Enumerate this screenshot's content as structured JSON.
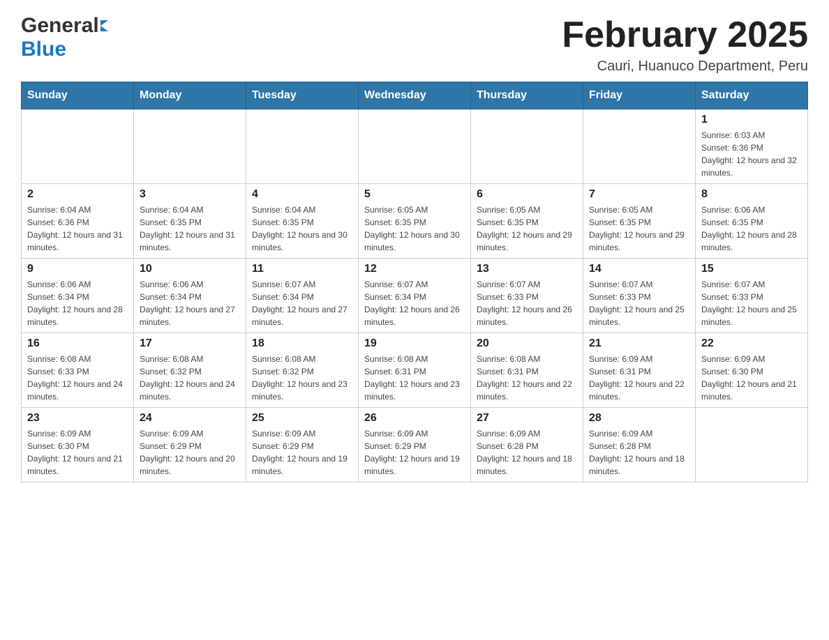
{
  "logo": {
    "general": "General",
    "blue": "Blue"
  },
  "header": {
    "title": "February 2025",
    "subtitle": "Cauri, Huanuco Department, Peru"
  },
  "weekdays": [
    "Sunday",
    "Monday",
    "Tuesday",
    "Wednesday",
    "Thursday",
    "Friday",
    "Saturday"
  ],
  "weeks": [
    [
      {
        "day": "",
        "info": ""
      },
      {
        "day": "",
        "info": ""
      },
      {
        "day": "",
        "info": ""
      },
      {
        "day": "",
        "info": ""
      },
      {
        "day": "",
        "info": ""
      },
      {
        "day": "",
        "info": ""
      },
      {
        "day": "1",
        "info": "Sunrise: 6:03 AM\nSunset: 6:36 PM\nDaylight: 12 hours and 32 minutes."
      }
    ],
    [
      {
        "day": "2",
        "info": "Sunrise: 6:04 AM\nSunset: 6:36 PM\nDaylight: 12 hours and 31 minutes."
      },
      {
        "day": "3",
        "info": "Sunrise: 6:04 AM\nSunset: 6:35 PM\nDaylight: 12 hours and 31 minutes."
      },
      {
        "day": "4",
        "info": "Sunrise: 6:04 AM\nSunset: 6:35 PM\nDaylight: 12 hours and 30 minutes."
      },
      {
        "day": "5",
        "info": "Sunrise: 6:05 AM\nSunset: 6:35 PM\nDaylight: 12 hours and 30 minutes."
      },
      {
        "day": "6",
        "info": "Sunrise: 6:05 AM\nSunset: 6:35 PM\nDaylight: 12 hours and 29 minutes."
      },
      {
        "day": "7",
        "info": "Sunrise: 6:05 AM\nSunset: 6:35 PM\nDaylight: 12 hours and 29 minutes."
      },
      {
        "day": "8",
        "info": "Sunrise: 6:06 AM\nSunset: 6:35 PM\nDaylight: 12 hours and 28 minutes."
      }
    ],
    [
      {
        "day": "9",
        "info": "Sunrise: 6:06 AM\nSunset: 6:34 PM\nDaylight: 12 hours and 28 minutes."
      },
      {
        "day": "10",
        "info": "Sunrise: 6:06 AM\nSunset: 6:34 PM\nDaylight: 12 hours and 27 minutes."
      },
      {
        "day": "11",
        "info": "Sunrise: 6:07 AM\nSunset: 6:34 PM\nDaylight: 12 hours and 27 minutes."
      },
      {
        "day": "12",
        "info": "Sunrise: 6:07 AM\nSunset: 6:34 PM\nDaylight: 12 hours and 26 minutes."
      },
      {
        "day": "13",
        "info": "Sunrise: 6:07 AM\nSunset: 6:33 PM\nDaylight: 12 hours and 26 minutes."
      },
      {
        "day": "14",
        "info": "Sunrise: 6:07 AM\nSunset: 6:33 PM\nDaylight: 12 hours and 25 minutes."
      },
      {
        "day": "15",
        "info": "Sunrise: 6:07 AM\nSunset: 6:33 PM\nDaylight: 12 hours and 25 minutes."
      }
    ],
    [
      {
        "day": "16",
        "info": "Sunrise: 6:08 AM\nSunset: 6:33 PM\nDaylight: 12 hours and 24 minutes."
      },
      {
        "day": "17",
        "info": "Sunrise: 6:08 AM\nSunset: 6:32 PM\nDaylight: 12 hours and 24 minutes."
      },
      {
        "day": "18",
        "info": "Sunrise: 6:08 AM\nSunset: 6:32 PM\nDaylight: 12 hours and 23 minutes."
      },
      {
        "day": "19",
        "info": "Sunrise: 6:08 AM\nSunset: 6:31 PM\nDaylight: 12 hours and 23 minutes."
      },
      {
        "day": "20",
        "info": "Sunrise: 6:08 AM\nSunset: 6:31 PM\nDaylight: 12 hours and 22 minutes."
      },
      {
        "day": "21",
        "info": "Sunrise: 6:09 AM\nSunset: 6:31 PM\nDaylight: 12 hours and 22 minutes."
      },
      {
        "day": "22",
        "info": "Sunrise: 6:09 AM\nSunset: 6:30 PM\nDaylight: 12 hours and 21 minutes."
      }
    ],
    [
      {
        "day": "23",
        "info": "Sunrise: 6:09 AM\nSunset: 6:30 PM\nDaylight: 12 hours and 21 minutes."
      },
      {
        "day": "24",
        "info": "Sunrise: 6:09 AM\nSunset: 6:29 PM\nDaylight: 12 hours and 20 minutes."
      },
      {
        "day": "25",
        "info": "Sunrise: 6:09 AM\nSunset: 6:29 PM\nDaylight: 12 hours and 19 minutes."
      },
      {
        "day": "26",
        "info": "Sunrise: 6:09 AM\nSunset: 6:29 PM\nDaylight: 12 hours and 19 minutes."
      },
      {
        "day": "27",
        "info": "Sunrise: 6:09 AM\nSunset: 6:28 PM\nDaylight: 12 hours and 18 minutes."
      },
      {
        "day": "28",
        "info": "Sunrise: 6:09 AM\nSunset: 6:28 PM\nDaylight: 12 hours and 18 minutes."
      },
      {
        "day": "",
        "info": ""
      }
    ]
  ]
}
